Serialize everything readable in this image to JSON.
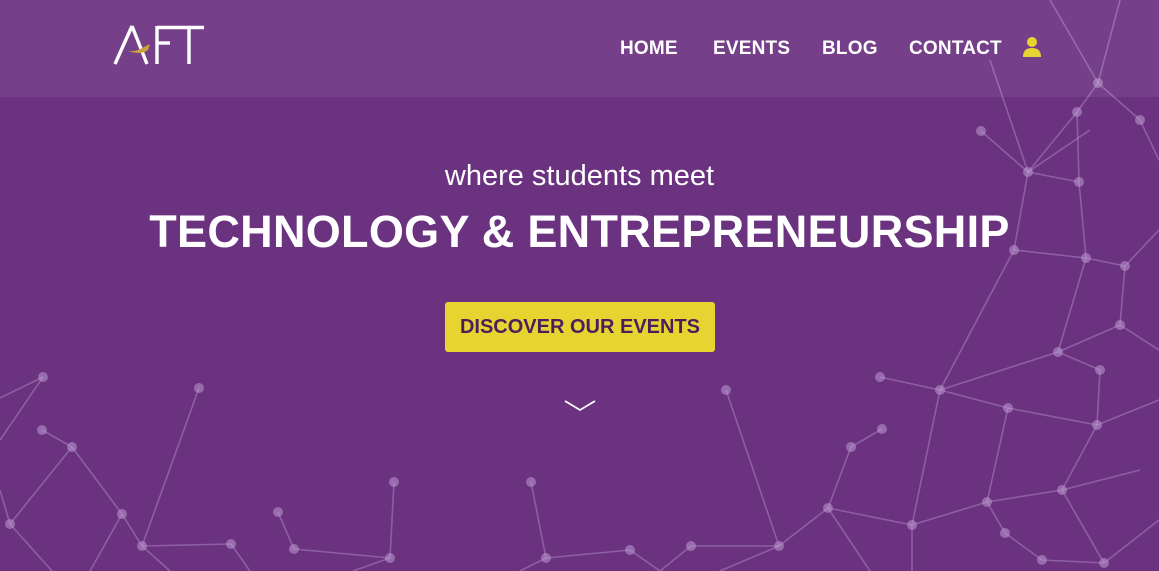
{
  "header": {
    "logo_text": "AFT",
    "nav": {
      "home": "HOME",
      "events": "EVENTS",
      "blog": "BLOG",
      "contact": "CONTACT"
    },
    "user_icon": "user-icon"
  },
  "hero": {
    "subtitle": "where students meet",
    "title": "TECHNOLOGY & ENTREPRENEURSHIP",
    "cta_label": "DISCOVER OUR EVENTS",
    "scroll_icon": "chevron-down-icon"
  },
  "colors": {
    "background": "#6b3280",
    "accent": "#e8d431",
    "cta_text": "#4a1f5c",
    "text": "#ffffff"
  }
}
